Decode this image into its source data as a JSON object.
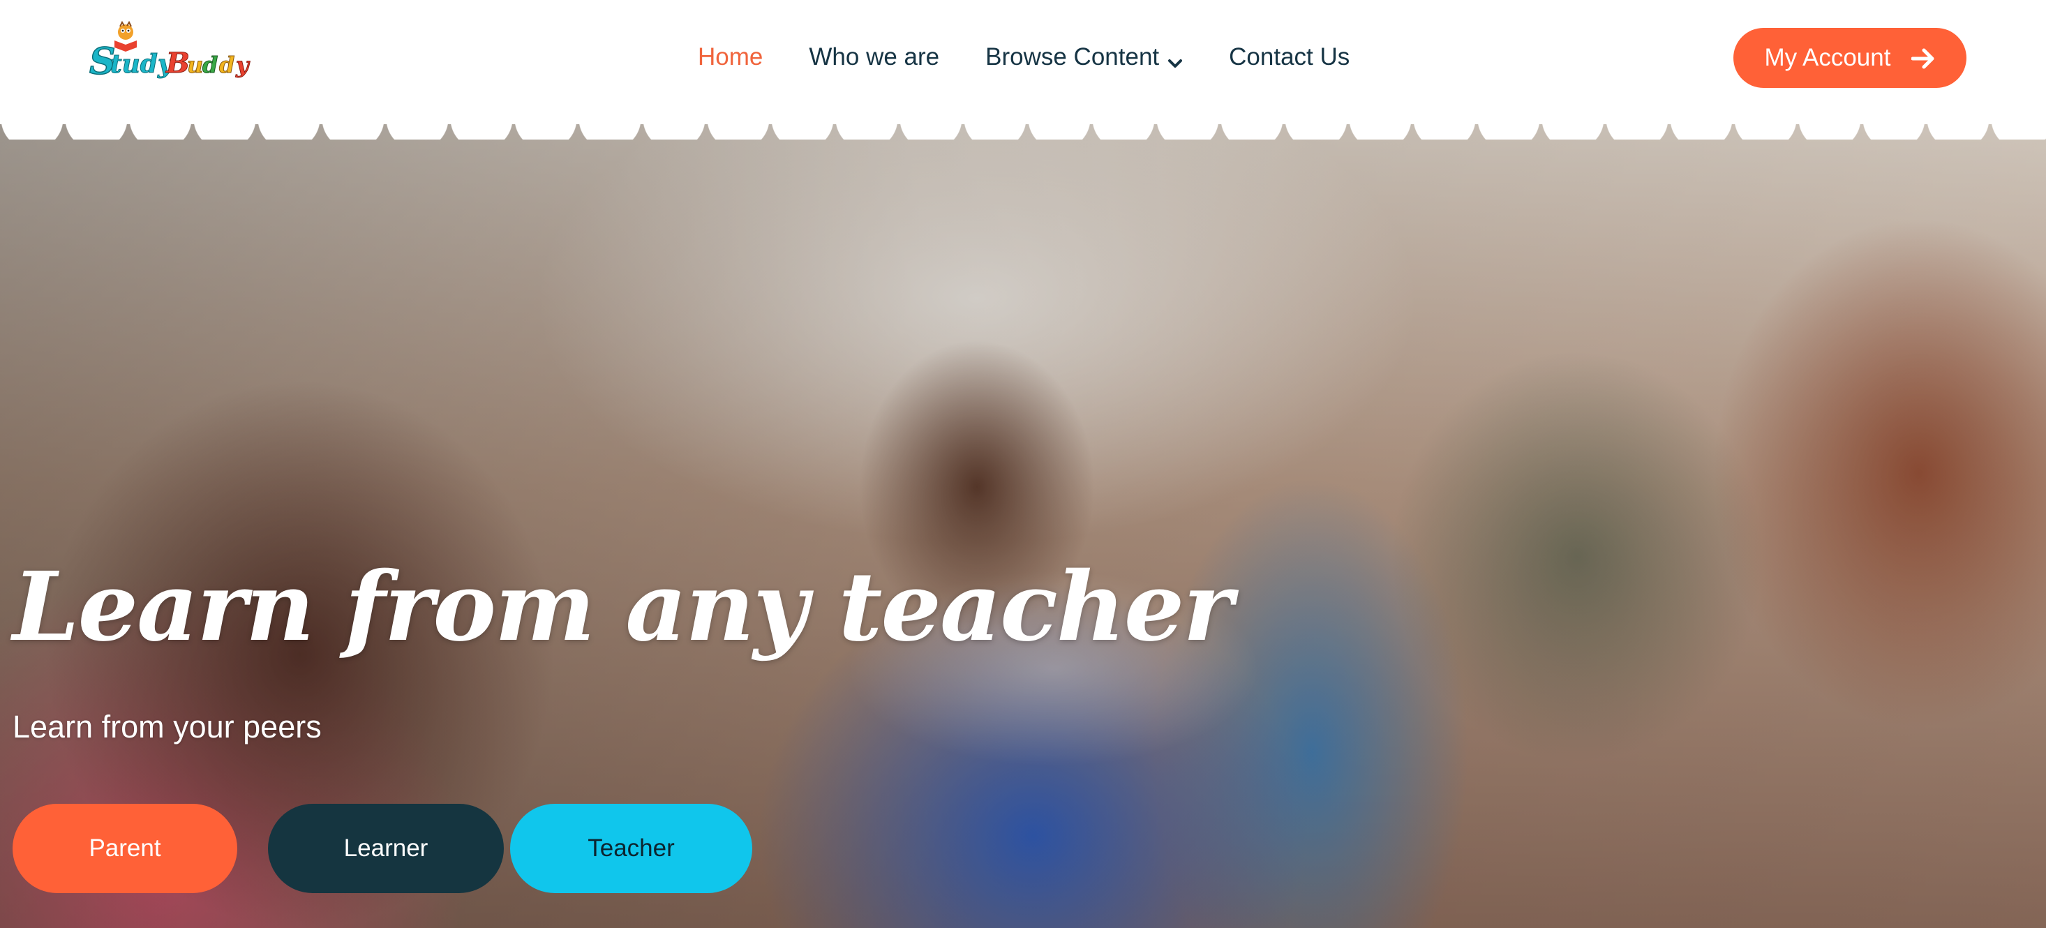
{
  "brand": {
    "logo_text": "StudyBuddy"
  },
  "nav": {
    "items": [
      {
        "label": "Home",
        "active": true
      },
      {
        "label": "Who we are"
      },
      {
        "label": "Browse Content",
        "has_dropdown": true
      },
      {
        "label": "Contact Us"
      }
    ]
  },
  "account": {
    "label": "My Account",
    "icon": "arrow-right-icon"
  },
  "hero": {
    "title": "Learn from any teacher",
    "subtitle": "Learn from your peers",
    "buttons": {
      "parent": "Parent",
      "learner": "Learner",
      "teacher": "Teacher"
    }
  },
  "colors": {
    "accent": "#ff6137",
    "nav_text": "#163444",
    "dark": "#153540",
    "cyan": "#10c6ec",
    "active_nav": "#f0643c"
  }
}
